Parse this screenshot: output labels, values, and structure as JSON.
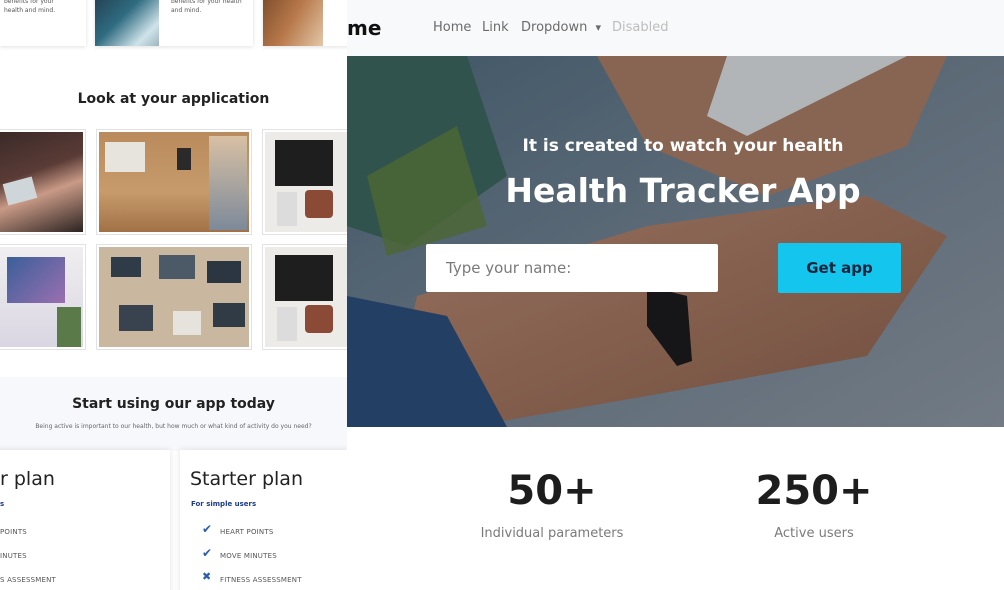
{
  "left_panel": {
    "top_card_text": "benefits for your health and mind.",
    "top_card_text_b": "benefits for your health and mind.",
    "gallery_title": "Look at your application",
    "start_title": "Start using our app today",
    "start_subtitle": "Being active is important to our health, but how much or what kind of activity do you need?",
    "plans": [
      {
        "title": "r plan",
        "subtitle": "s",
        "features": [
          "POINTS",
          "INUTES",
          "S ASSESSMENT"
        ]
      },
      {
        "title": "Starter plan",
        "subtitle": "For simple users",
        "features": [
          {
            "label": "HEART POINTS",
            "status": "check"
          },
          {
            "label": "MOVE MINUTES",
            "status": "check"
          },
          {
            "label": "FITNESS ASSESSMENT",
            "status": "cross"
          }
        ]
      }
    ]
  },
  "navbar": {
    "brand": "me",
    "links": [
      "Home",
      "Link",
      "Dropdown",
      "Disabled"
    ]
  },
  "hero": {
    "tagline": "It is created to watch your health",
    "title": "Health Tracker App",
    "input_placeholder": "Type your name:",
    "button": "Get app"
  },
  "stats": [
    {
      "value": "50+",
      "label": "Individual parameters"
    },
    {
      "value": "250+",
      "label": "Active users"
    }
  ],
  "icons": {
    "check": "✔",
    "cross": "✖",
    "caret": "▾"
  },
  "colors": {
    "accent": "#14c6ee",
    "check": "#2a5db0",
    "navbar_bg": "#f8f9fa"
  }
}
